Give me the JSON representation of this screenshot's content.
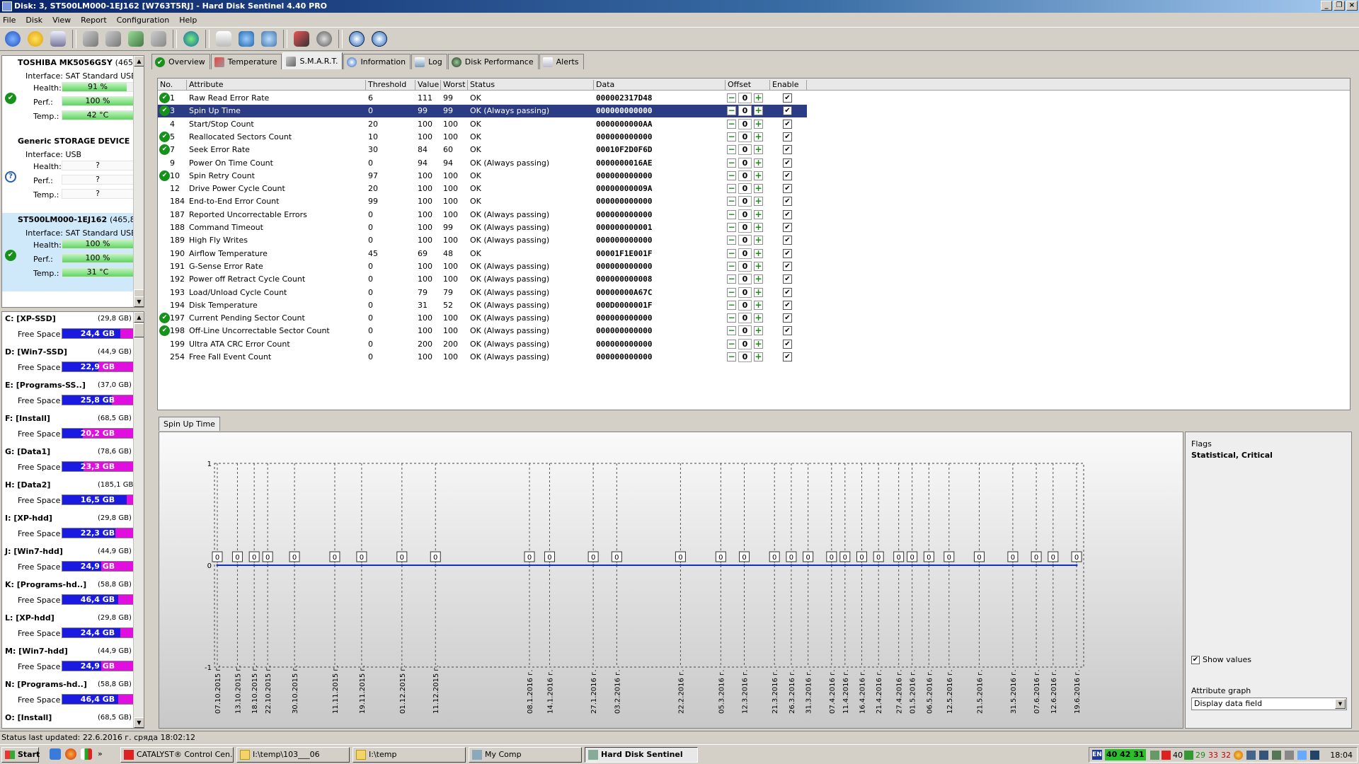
{
  "window": {
    "title": "Disk: 3, ST500LM000-1EJ162 [W763T5RJ]  -  Hard Disk Sentinel 4.40 PRO"
  },
  "menu": [
    "File",
    "Disk",
    "View",
    "Report",
    "Configuration",
    "Help"
  ],
  "disks": [
    {
      "name": "TOSHIBA MK5056GSY",
      "size": "(465,8",
      "interface": "Interface:  SAT Standard USB/A",
      "health": "91 %",
      "health_frac": 0.91,
      "perf": "100 %",
      "perf_frac": 1.0,
      "temp": "42 °C",
      "temp_frac": 1.0,
      "status": "ok",
      "selected": false
    },
    {
      "name": "Generic STORAGE DEVICE",
      "size": "",
      "interface": "Interface:  USB",
      "health": "?",
      "health_frac": 0,
      "perf": "?",
      "perf_frac": 0,
      "temp": "?",
      "temp_frac": 0,
      "status": "unknown",
      "selected": false
    },
    {
      "name": "ST500LM000-1EJ162",
      "size": "(465,8 G",
      "interface": "Interface:  SAT Standard USB/A",
      "health": "100 %",
      "health_frac": 1.0,
      "perf": "100 %",
      "perf_frac": 1.0,
      "temp": "31 °C",
      "temp_frac": 1.0,
      "status": "ok",
      "selected": true
    }
  ],
  "disk_labels": {
    "health": "Health:",
    "perf": "Perf.:",
    "temp": "Temp.:"
  },
  "volumes": [
    {
      "name": "C: [XP-SSD]",
      "size": "(29,8 GB)",
      "free": "24,4 GB",
      "frac": 0.82
    },
    {
      "name": "D: [Win7-SSD]",
      "size": "(44,9 GB)",
      "free": "22,9 GB",
      "frac": 0.51
    },
    {
      "name": "E: [Programs-SS..]",
      "size": "(37,0 GB)",
      "free": "25,8 GB",
      "frac": 0.7
    },
    {
      "name": "F: [Install]",
      "size": "(68,5 GB)",
      "free": "20,2 GB",
      "frac": 0.29
    },
    {
      "name": "G: [Data1]",
      "size": "(78,6 GB)",
      "free": "23,3 GB",
      "frac": 0.3
    },
    {
      "name": "H: [Data2]",
      "size": "(185,1 GB)",
      "free": "16,5 GB",
      "frac": 0.91
    },
    {
      "name": "I: [XP-hdd]",
      "size": "(29,8 GB)",
      "free": "22,3 GB",
      "frac": 0.75
    },
    {
      "name": "J: [Win7-hdd]",
      "size": "(44,9 GB)",
      "free": "24,9 GB",
      "frac": 0.55
    },
    {
      "name": "K: [Programs-hd..]",
      "size": "(58,8 GB)",
      "free": "46,4 GB",
      "frac": 0.79
    },
    {
      "name": "L: [XP-hdd]",
      "size": "(29,8 GB)",
      "free": "24,4 GB",
      "frac": 0.82
    },
    {
      "name": "M: [Win7-hdd]",
      "size": "(44,9 GB)",
      "free": "24,9 GB",
      "frac": 0.55
    },
    {
      "name": "N: [Programs-hd..]",
      "size": "(58,8 GB)",
      "free": "46,4 GB",
      "frac": 0.79
    },
    {
      "name": "O: [Install]",
      "size": "(68,5 GB)",
      "free": "",
      "frac": 0.3
    }
  ],
  "free_space_label": "Free Space",
  "tabs": [
    "Overview",
    "Temperature",
    "S.M.A.R.T.",
    "Information",
    "Log",
    "Disk Performance",
    "Alerts"
  ],
  "columns": [
    "No.",
    "Attribute",
    "Threshold",
    "Value",
    "Worst",
    "Status",
    "Data",
    "Offset",
    "Enable"
  ],
  "attributes": [
    {
      "no": "1",
      "name": "Raw Read Error Rate",
      "thr": "6",
      "val": "111",
      "worst": "99",
      "status": "OK",
      "data": "000002317D48",
      "ok": true,
      "sel": false
    },
    {
      "no": "3",
      "name": "Spin Up Time",
      "thr": "0",
      "val": "99",
      "worst": "99",
      "status": "OK (Always passing)",
      "data": "000000000000",
      "ok": true,
      "sel": true
    },
    {
      "no": "4",
      "name": "Start/Stop Count",
      "thr": "20",
      "val": "100",
      "worst": "100",
      "status": "OK",
      "data": "0000000000AA",
      "ok": false,
      "sel": false
    },
    {
      "no": "5",
      "name": "Reallocated Sectors Count",
      "thr": "10",
      "val": "100",
      "worst": "100",
      "status": "OK",
      "data": "000000000000",
      "ok": true,
      "sel": false
    },
    {
      "no": "7",
      "name": "Seek Error Rate",
      "thr": "30",
      "val": "84",
      "worst": "60",
      "status": "OK",
      "data": "00010F2D0F6D",
      "ok": true,
      "sel": false
    },
    {
      "no": "9",
      "name": "Power On Time Count",
      "thr": "0",
      "val": "94",
      "worst": "94",
      "status": "OK (Always passing)",
      "data": "0000000016AE",
      "ok": false,
      "sel": false
    },
    {
      "no": "10",
      "name": "Spin Retry Count",
      "thr": "97",
      "val": "100",
      "worst": "100",
      "status": "OK",
      "data": "000000000000",
      "ok": true,
      "sel": false
    },
    {
      "no": "12",
      "name": "Drive Power Cycle Count",
      "thr": "20",
      "val": "100",
      "worst": "100",
      "status": "OK",
      "data": "00000000009A",
      "ok": false,
      "sel": false
    },
    {
      "no": "184",
      "name": "End-to-End Error Count",
      "thr": "99",
      "val": "100",
      "worst": "100",
      "status": "OK",
      "data": "000000000000",
      "ok": false,
      "sel": false
    },
    {
      "no": "187",
      "name": "Reported Uncorrectable Errors",
      "thr": "0",
      "val": "100",
      "worst": "100",
      "status": "OK (Always passing)",
      "data": "000000000000",
      "ok": false,
      "sel": false
    },
    {
      "no": "188",
      "name": "Command Timeout",
      "thr": "0",
      "val": "100",
      "worst": "99",
      "status": "OK (Always passing)",
      "data": "000000000001",
      "ok": false,
      "sel": false
    },
    {
      "no": "189",
      "name": "High Fly Writes",
      "thr": "0",
      "val": "100",
      "worst": "100",
      "status": "OK (Always passing)",
      "data": "000000000000",
      "ok": false,
      "sel": false
    },
    {
      "no": "190",
      "name": "Airflow Temperature",
      "thr": "45",
      "val": "69",
      "worst": "48",
      "status": "OK",
      "data": "00001F1E001F",
      "ok": false,
      "sel": false
    },
    {
      "no": "191",
      "name": "G-Sense Error Rate",
      "thr": "0",
      "val": "100",
      "worst": "100",
      "status": "OK (Always passing)",
      "data": "000000000000",
      "ok": false,
      "sel": false
    },
    {
      "no": "192",
      "name": "Power off Retract Cycle Count",
      "thr": "0",
      "val": "100",
      "worst": "100",
      "status": "OK (Always passing)",
      "data": "000000000008",
      "ok": false,
      "sel": false
    },
    {
      "no": "193",
      "name": "Load/Unload Cycle Count",
      "thr": "0",
      "val": "79",
      "worst": "79",
      "status": "OK (Always passing)",
      "data": "00000000A67C",
      "ok": false,
      "sel": false
    },
    {
      "no": "194",
      "name": "Disk Temperature",
      "thr": "0",
      "val": "31",
      "worst": "52",
      "status": "OK (Always passing)",
      "data": "000D0000001F",
      "ok": false,
      "sel": false
    },
    {
      "no": "197",
      "name": "Current Pending Sector Count",
      "thr": "0",
      "val": "100",
      "worst": "100",
      "status": "OK (Always passing)",
      "data": "000000000000",
      "ok": true,
      "sel": false
    },
    {
      "no": "198",
      "name": "Off-Line Uncorrectable Sector Count",
      "thr": "0",
      "val": "100",
      "worst": "100",
      "status": "OK (Always passing)",
      "data": "000000000000",
      "ok": true,
      "sel": false
    },
    {
      "no": "199",
      "name": "Ultra ATA CRC Error Count",
      "thr": "0",
      "val": "200",
      "worst": "200",
      "status": "OK (Always passing)",
      "data": "000000000000",
      "ok": false,
      "sel": false
    },
    {
      "no": "254",
      "name": "Free Fall Event Count",
      "thr": "0",
      "val": "100",
      "worst": "100",
      "status": "OK (Always passing)",
      "data": "000000000000",
      "ok": false,
      "sel": false
    }
  ],
  "offset_value": "0",
  "graph_tab": "Spin Up Time",
  "chart_data": {
    "type": "line",
    "title": "Spin Up Time",
    "ylim": [
      -1,
      1
    ],
    "y_ticks": [
      "1",
      "0",
      "-1"
    ],
    "x": [
      "07.10.2015 г.",
      "13.10.2015 г.",
      "18.10.2015 г.",
      "22.10.2015 г.",
      "30.10.2015 г.",
      "11.11.2015 г.",
      "19.11.2015 г.",
      "01.12.2015 г.",
      "11.12.2015 г.",
      "08.1.2016 г.",
      "14.1.2016 г.",
      "27.1.2016 г.",
      "03.2.2016 г.",
      "22.2.2016 г.",
      "05.3.2016 г.",
      "12.3.2016 г.",
      "21.3.2016 г.",
      "26.3.2016 г.",
      "31.3.2016 г.",
      "07.4.2016 г.",
      "11.4.2016 г.",
      "16.4.2016 г.",
      "21.4.2016 г.",
      "27.4.2016 г.",
      "01.5.2016 г.",
      "06.5.2016 г.",
      "12.5.2016 г.",
      "21.5.2016 г.",
      "31.5.2016 г.",
      "07.6.2016 г.",
      "12.6.2016 г.",
      "19.6.2016 г."
    ],
    "values": [
      0,
      0,
      0,
      0,
      0,
      0,
      0,
      0,
      0,
      0,
      0,
      0,
      0,
      0,
      0,
      0,
      0,
      0,
      0,
      0,
      0,
      0,
      0,
      0,
      0,
      0,
      0,
      0,
      0,
      0,
      0,
      0
    ],
    "series_color": "#1030c0"
  },
  "flags": {
    "label": "Flags",
    "value": "Statistical, Critical",
    "show_values": "Show values",
    "attr_graph": "Attribute graph",
    "select": "Display data field"
  },
  "status": "Status last updated: 22.6.2016 г. сряда 18:02:12",
  "taskbar": {
    "start": "Start",
    "tasks": [
      "CATALYST® Control Cen...",
      "I:\\temp\\103___06",
      "I:\\temp",
      "My Comp",
      "Hard Disk Sentinel"
    ],
    "lang": "EN",
    "temps": "40 42 31",
    "t2": "40",
    "t3": "29",
    "t4": "33",
    "t5": "32",
    "clock": "18:04"
  }
}
